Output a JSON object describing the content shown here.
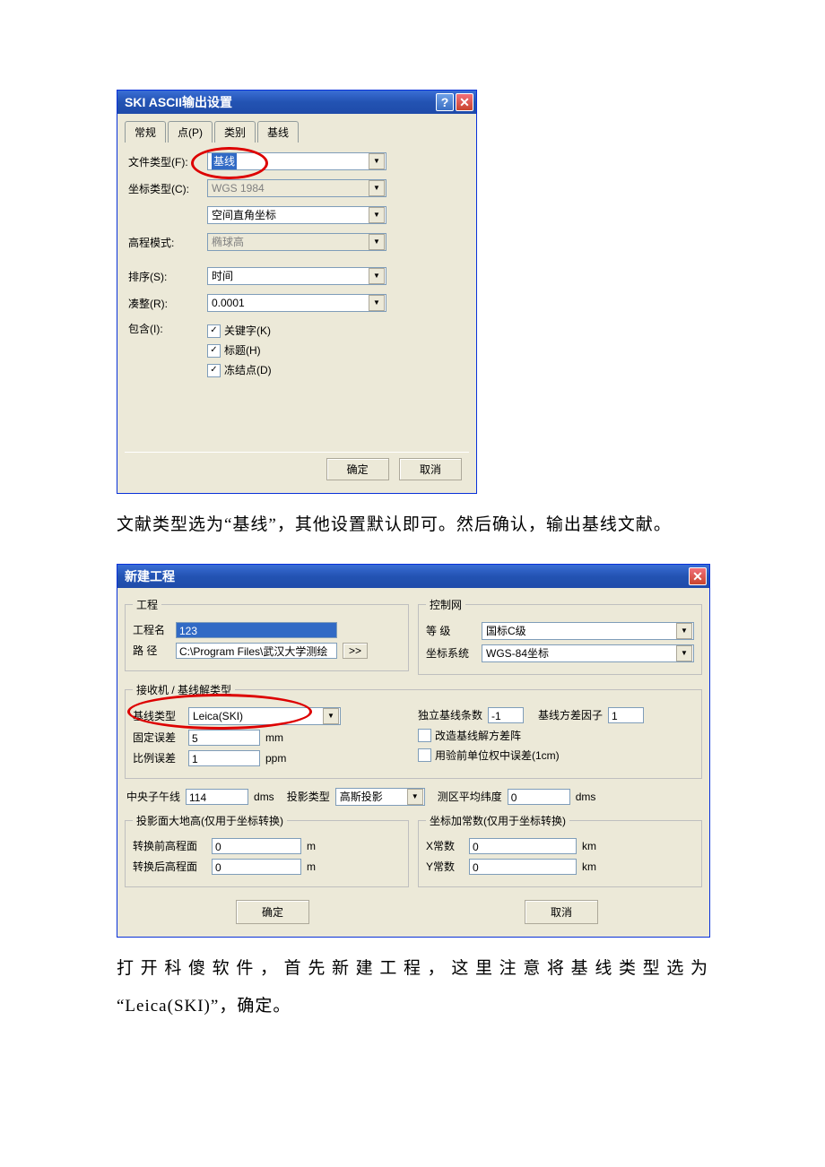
{
  "dlg1": {
    "title": "SKI ASCII输出设置",
    "tabs": [
      "常规",
      "点(P)",
      "类别",
      "基线"
    ],
    "file_type_label": "文件类型(F):",
    "file_type_value": "基线",
    "coord_type_label": "坐标类型(C):",
    "coord_type_value1": "WGS 1984",
    "coord_type_value2": "空间直角坐标",
    "height_mode_label": "高程模式:",
    "height_mode_value": "椭球高",
    "sort_label": "排序(S):",
    "sort_value": "时间",
    "round_label": "凑整(R):",
    "round_value": "0.0001",
    "include_label": "包含(I):",
    "chk_keyword": "关键字(K)",
    "chk_title": "标题(H)",
    "chk_freeze": "冻结点(D)",
    "ok": "确定",
    "cancel": "取消"
  },
  "para1": "文献类型选为“基线”，其他设置默认即可。然后确认，输出基线文献。",
  "dlg2": {
    "title": "新建工程",
    "grp_project": "工程",
    "project_name_label": "工程名",
    "project_name_value": "123",
    "path_label": "路  径",
    "path_value": "C:\\Program Files\\武汉大学测绘",
    "browse": ">>",
    "grp_control": "控制网",
    "grade_label": "等      级",
    "grade_value": "国标C级",
    "coord_sys_label": "坐标系统",
    "coord_sys_value": "WGS-84坐标",
    "grp_receiver": "接收机 / 基线解类型",
    "baseline_type_label": "基线类型",
    "baseline_type_value": "Leica(SKI)",
    "indep_baseline_label": "独立基线条数",
    "indep_baseline_value": "-1",
    "var_factor_label": "基线方差因子",
    "var_factor_value": "1",
    "fixed_err_label": "固定误差",
    "fixed_err_value": "5",
    "fixed_err_unit": "mm",
    "chk_modify": "改造基线解方差阵",
    "ratio_err_label": "比例误差",
    "ratio_err_value": "1",
    "ratio_err_unit": "ppm",
    "chk_prior": "用验前单位权中误差(1cm)",
    "central_meridian_label": "中央子午线",
    "central_meridian_value": "114",
    "dms": "dms",
    "proj_type_label": "投影类型",
    "proj_type_value": "高斯投影",
    "avg_lat_label": "测区平均纬度",
    "avg_lat_value": "0",
    "grp_proj_height": "投影面大地高(仅用于坐标转换)",
    "before_label": "转换前高程面",
    "before_value": "0",
    "after_label": "转换后高程面",
    "after_value": "0",
    "m": "m",
    "grp_offset": "坐标加常数(仅用于坐标转换)",
    "x_const_label": "X常数",
    "x_const_value": "0",
    "y_const_label": "Y常数",
    "y_const_value": "0",
    "km": "km",
    "ok": "确定",
    "cancel": "取消"
  },
  "para2a": "打开科傻软件，首先新建工程，这里注意将基线类型选为",
  "para2b": "“Leica(SKI)”，确定。"
}
